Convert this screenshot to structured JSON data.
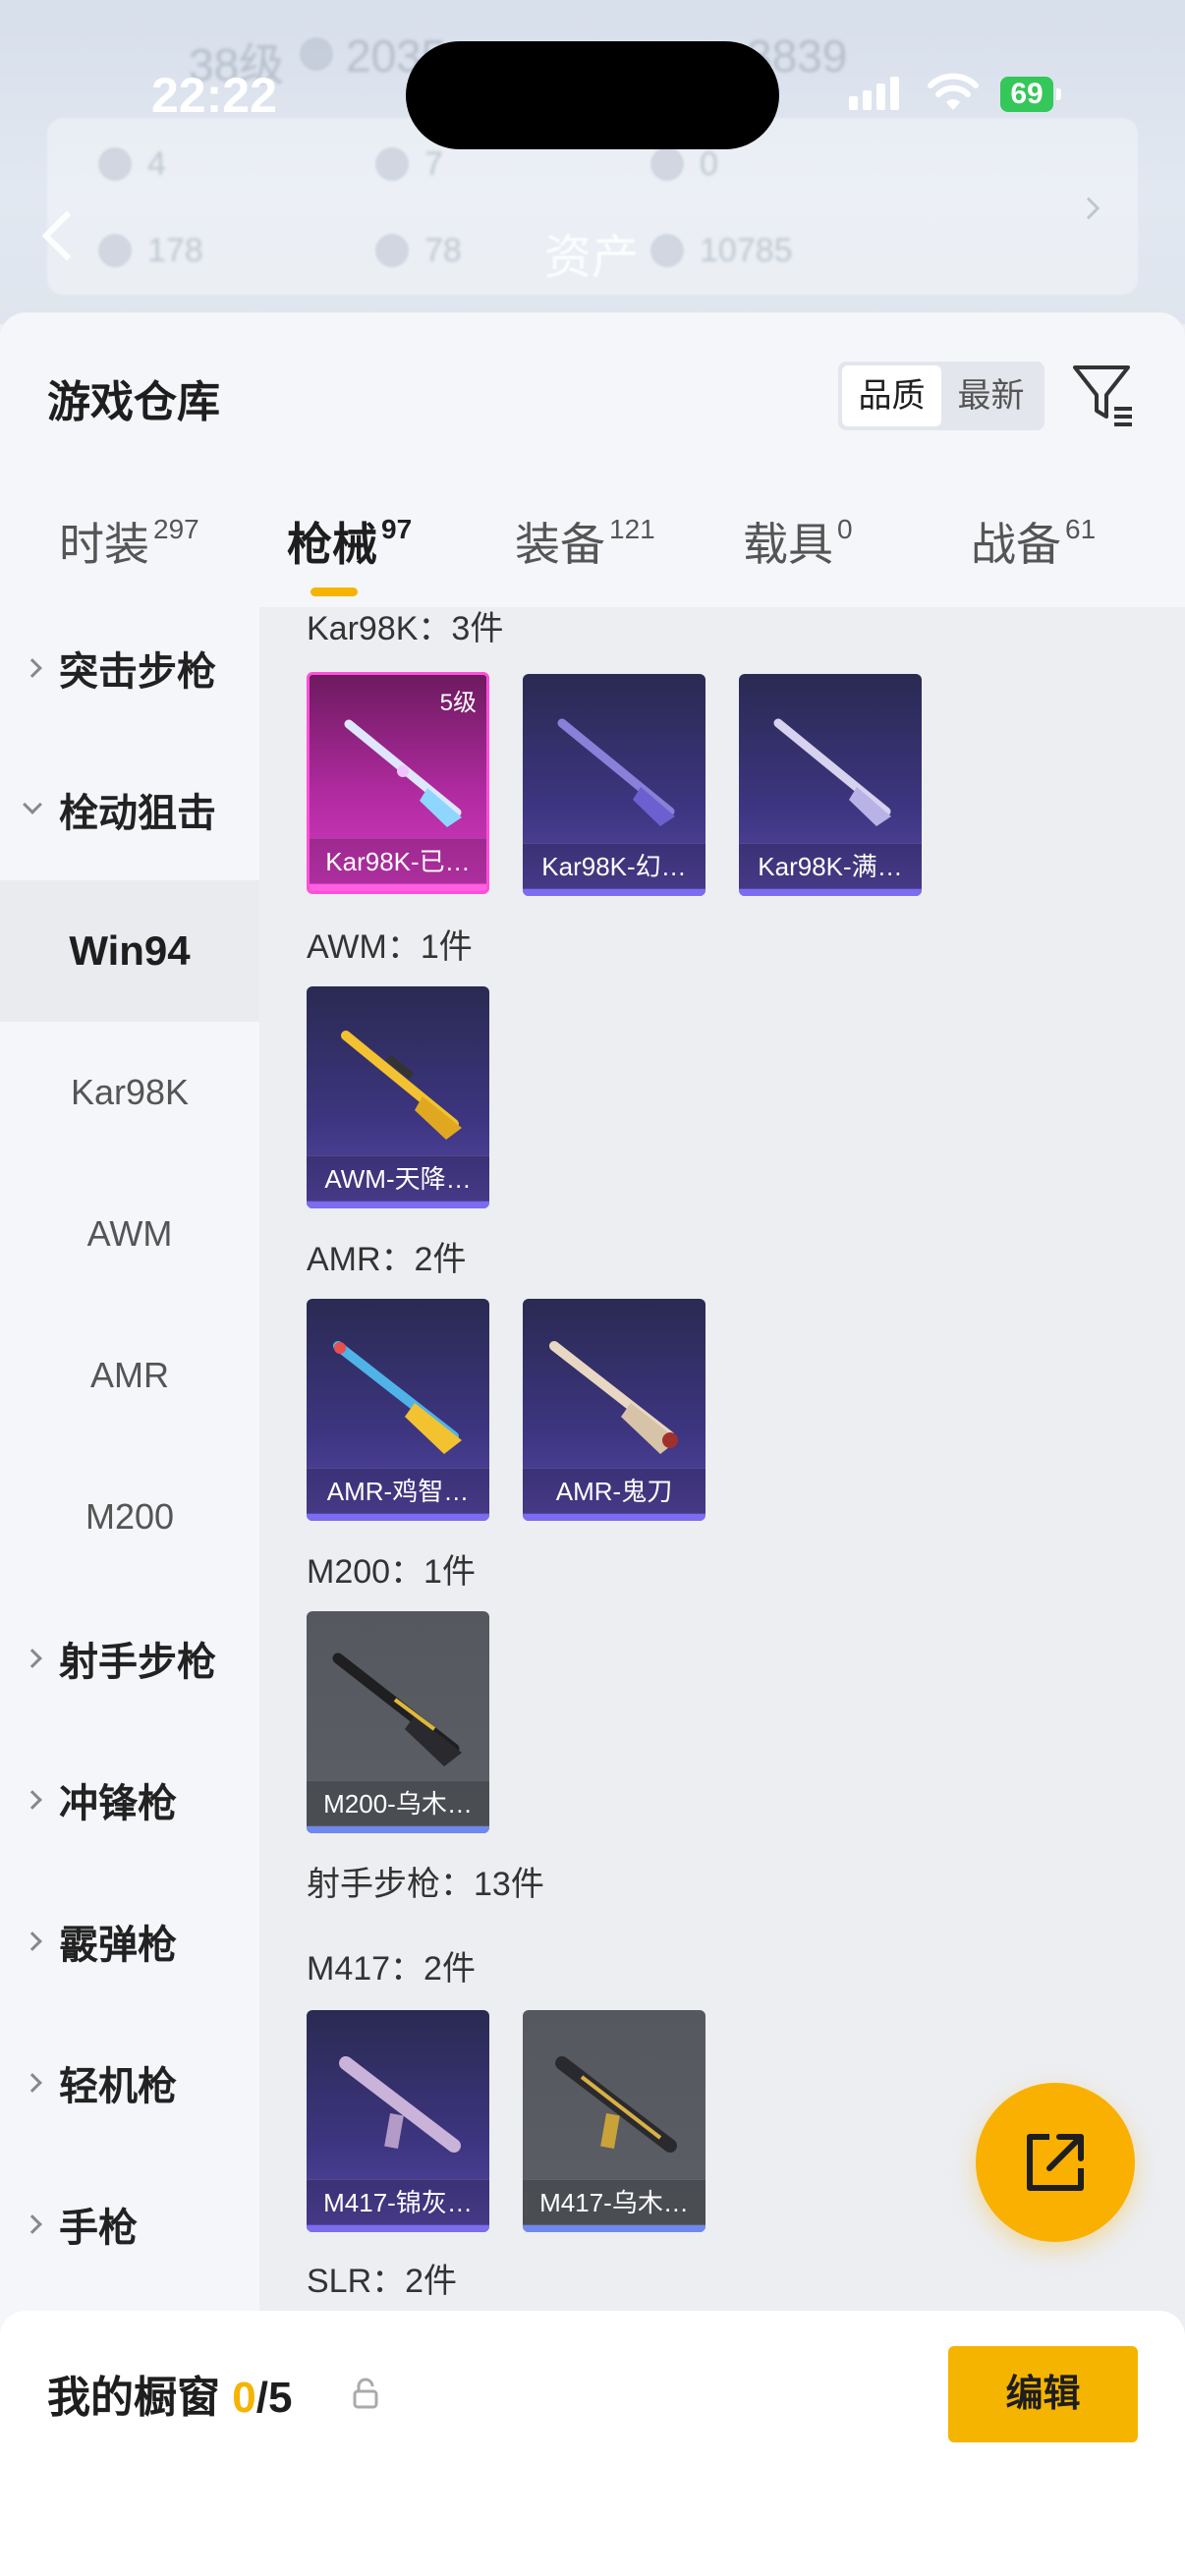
{
  "status_bar": {
    "time": "22:22",
    "battery": "69"
  },
  "background_header": {
    "title": "资产",
    "ghost_level": "38级",
    "ghost_coins": "2035",
    "ghost_other": "3839",
    "ghost_row1": [
      "4",
      "7",
      "0"
    ],
    "ghost_row2": [
      "178",
      "78",
      "10785"
    ]
  },
  "warehouse": {
    "title": "游戏仓库",
    "sort_options": [
      "品质",
      "最新"
    ],
    "sort_selected": "品质"
  },
  "tabs": [
    {
      "label": "时装",
      "count": "297"
    },
    {
      "label": "枪械",
      "count": "97",
      "active": true
    },
    {
      "label": "装备",
      "count": "121"
    },
    {
      "label": "载具",
      "count": "0"
    },
    {
      "label": "战备",
      "count": "61"
    }
  ],
  "side_nav": {
    "items": [
      {
        "label": "突击步枪",
        "type": "category"
      },
      {
        "label": "栓动狙击",
        "type": "category",
        "expanded": true
      },
      {
        "label": "Win94",
        "type": "sub",
        "selected": true
      },
      {
        "label": "Kar98K",
        "type": "sub"
      },
      {
        "label": "AWM",
        "type": "sub"
      },
      {
        "label": "AMR",
        "type": "sub"
      },
      {
        "label": "M200",
        "type": "sub"
      },
      {
        "label": "射手步枪",
        "type": "category"
      },
      {
        "label": "冲锋枪",
        "type": "category"
      },
      {
        "label": "霰弹枪",
        "type": "category"
      },
      {
        "label": "轻机枪",
        "type": "category"
      },
      {
        "label": "手枪",
        "type": "category"
      }
    ]
  },
  "content": {
    "groups": [
      {
        "title": "Kar98K：3件",
        "cards": [
          {
            "name": "Kar98K-已…",
            "rarity": "pink",
            "level": "5级"
          },
          {
            "name": "Kar98K-幻…",
            "rarity": "purple"
          },
          {
            "name": "Kar98K-满…",
            "rarity": "purple"
          }
        ]
      },
      {
        "title": "AWM：1件",
        "cards": [
          {
            "name": "AWM-天降…",
            "rarity": "purple"
          }
        ]
      },
      {
        "title": "AMR：2件",
        "cards": [
          {
            "name": "AMR-鸡智…",
            "rarity": "purple"
          },
          {
            "name": "AMR-鬼刀",
            "rarity": "purple"
          }
        ]
      },
      {
        "title": "M200：1件",
        "cards": [
          {
            "name": "M200-乌木…",
            "rarity": "gray"
          }
        ]
      },
      {
        "title": "射手步枪：13件",
        "cards": []
      },
      {
        "title": "M417：2件",
        "cards": [
          {
            "name": "M417-锦灰…",
            "rarity": "purple"
          },
          {
            "name": "M417-乌木…",
            "rarity": "gray"
          }
        ]
      },
      {
        "title": "SLR：2件",
        "cards": []
      }
    ]
  },
  "showcase": {
    "label": "我的橱窗",
    "count": "0",
    "total": "/5",
    "edit_label": "编辑"
  },
  "colors": {
    "accent": "#f5b400",
    "rarity_purple": "#7b6cf0",
    "rarity_pink": "#ff4fd8"
  }
}
